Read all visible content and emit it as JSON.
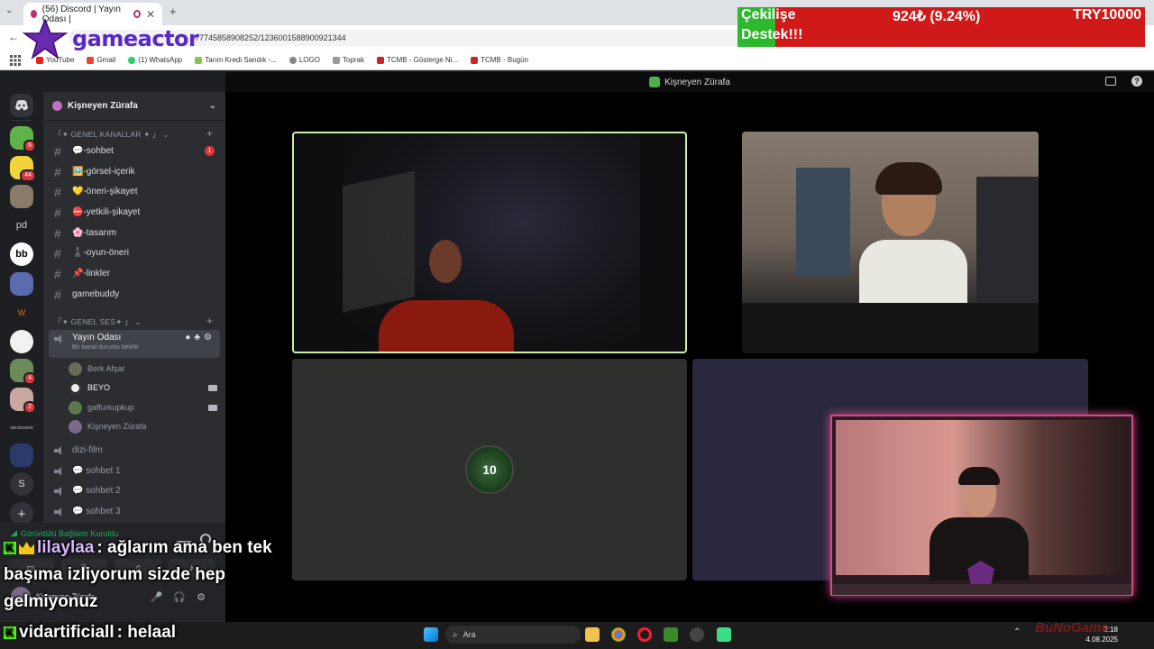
{
  "browser": {
    "tabs": [
      {
        "label": "(56) Discord | Yayın Odası |"
      },
      {
        "label": ""
      }
    ],
    "url": "77745858908252/1236001588900921344",
    "bookmarks": [
      "YouTube",
      "Gmail",
      "(1) WhatsApp",
      "Tarım Kredi Sandık -...",
      "LOGO",
      "Toprak",
      "TCMB - Gösterge Ni...",
      "TCMB - Bugün"
    ]
  },
  "overlay": {
    "logo_text": "gameactor",
    "donation": {
      "label_1": "Çekilişe",
      "label_2": "Destek!!!",
      "amount": "924₺ (9.24%)",
      "goal": "TRY10000",
      "progress": 0.0924
    },
    "chat": [
      {
        "user": "lilaylaa",
        "message": ": ağlarım ama ben tek"
      },
      {
        "user": "",
        "message": "başıma izliyorum sizde hep"
      },
      {
        "user": "",
        "message": "gelmiyonuz"
      },
      {
        "user": "vidartificiall",
        "message": ": helaal"
      }
    ],
    "bunoga": "BuNoGame"
  },
  "discord": {
    "title": "Kişneyen Zürafa",
    "guild_name": "Kişneyen Zürafa",
    "servers": [
      {
        "label": "",
        "badge": "6"
      },
      {
        "label": "",
        "badge": "44"
      },
      {
        "label": "",
        "badge": ""
      },
      {
        "label": "pd",
        "badge": ""
      },
      {
        "label": "bb",
        "badge": ""
      },
      {
        "label": "",
        "badge": ""
      },
      {
        "label": "",
        "badge": ""
      },
      {
        "label": "",
        "badge": ""
      },
      {
        "label": "",
        "badge": "4"
      },
      {
        "label": "",
        "badge": "2"
      },
      {
        "label": "",
        "badge": ""
      },
      {
        "label": "",
        "badge": ""
      },
      {
        "label": "S",
        "badge": ""
      },
      {
        "label": "+",
        "badge": ""
      }
    ],
    "category_text": "「✦ GENEL KANALLAR ✦ 」",
    "category_voice": "「✦ GENEL SES✦ 」",
    "text_channels": [
      {
        "name": "💬-sohbet",
        "badge": "1"
      },
      {
        "name": "🖼️-görsel-içerik"
      },
      {
        "name": "💛-öneri-şikayet"
      },
      {
        "name": "⛔-yetkili-şikayet"
      },
      {
        "name": "🌸-tasarım"
      },
      {
        "name": "♟️-oyun-öneri"
      },
      {
        "name": "📌-linkler"
      },
      {
        "name": "gamebuddy"
      }
    ],
    "voice_active": {
      "name": "Yayın Odası",
      "status": "Bir kanal durumu belirle"
    },
    "voice_users": [
      "Berk Afşar",
      "BEYO",
      "gaffurkupkup",
      "Kişneyen Zürafa"
    ],
    "voice_channels": [
      "dizi-film",
      "💬 sohbet 1",
      "💬 sohbet 2",
      "💬 sohbet 3"
    ],
    "connection": "Görüntülü Bağlantı Kuruldu",
    "self_name": "Kişneyen Zürafa"
  },
  "taskbar": {
    "search": "Ara",
    "time": "2:18",
    "date": "4.08.2025"
  }
}
